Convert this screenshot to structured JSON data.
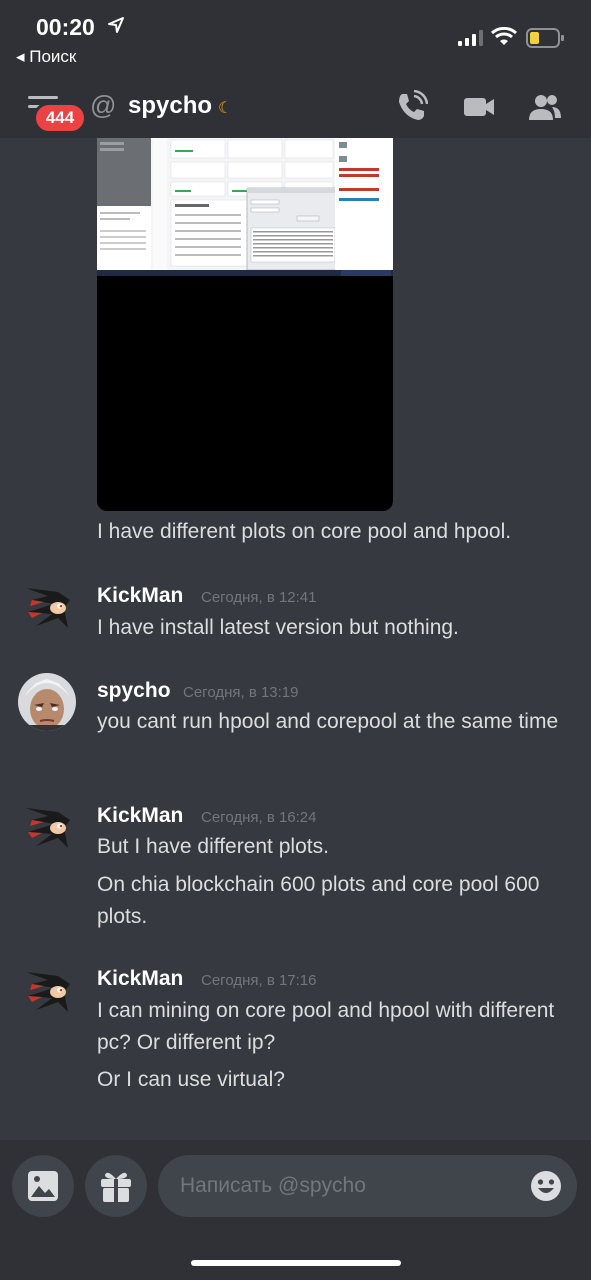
{
  "status_bar": {
    "time": "00:20",
    "back_label": "◂ Поиск"
  },
  "header": {
    "unread_count": "444",
    "channel_name": "spycho",
    "status_icon": "moon-icon"
  },
  "messages": {
    "m1_text": "I have different plots on core pool and hpool.",
    "g2_author": "KickMan",
    "g2_time": "Сегодня, в 12:41",
    "g2_line1": "I have install latest version but nothing.",
    "g3_author": "spycho",
    "g3_time": "Сегодня, в 13:19",
    "g3_line1": "you cant run hpool and corepool at the same time",
    "g4_author": "KickMan",
    "g4_time": "Сегодня, в 16:24",
    "g4_line1": "But I have different plots.",
    "g4_line2": "On chia blockchain 600 plots and core pool 600 plots.",
    "g5_author": "KickMan",
    "g5_time": "Сегодня, в 17:16",
    "g5_line1": "I can mining on core pool and hpool with different pc? Or different ip?",
    "g5_line2": "Or I can use virtual?"
  },
  "composer": {
    "placeholder": "Написать @spycho"
  },
  "colors": {
    "background": "#36393f",
    "header": "#2f3136",
    "badge": "#ed4245",
    "idle_moon": "#faa61a"
  }
}
